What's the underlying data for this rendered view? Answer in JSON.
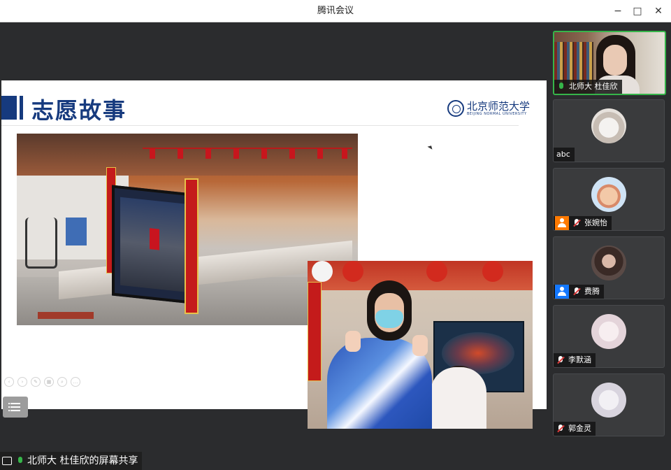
{
  "window": {
    "title": "腾讯会议",
    "minimize_glyph": "−",
    "maximize_glyph": "□",
    "close_glyph": "✕"
  },
  "slide": {
    "title": "志愿故事",
    "logo_text": "北京师范大学",
    "logo_subtext": "BEIJING NORMAL UNIVERSITY"
  },
  "share": {
    "label": "北师大 杜佳欣的屏幕共享"
  },
  "participants": [
    {
      "name": "北师大 杜佳欣",
      "mic": "on",
      "video": true,
      "active": true
    },
    {
      "name": "abc",
      "mic": "none",
      "video": false
    },
    {
      "name": "张婉怡",
      "mic": "off",
      "video": false,
      "badge": "orange"
    },
    {
      "name": "费腾",
      "mic": "off",
      "video": false,
      "badge": "blue"
    },
    {
      "name": "李默涵",
      "mic": "off",
      "video": false
    },
    {
      "name": "郭金灵",
      "mic": "off",
      "video": false
    }
  ],
  "colors": {
    "accent_green": "#36b54a",
    "slide_blue": "#163a7e",
    "mic_muted_red": "#e03b3b"
  }
}
